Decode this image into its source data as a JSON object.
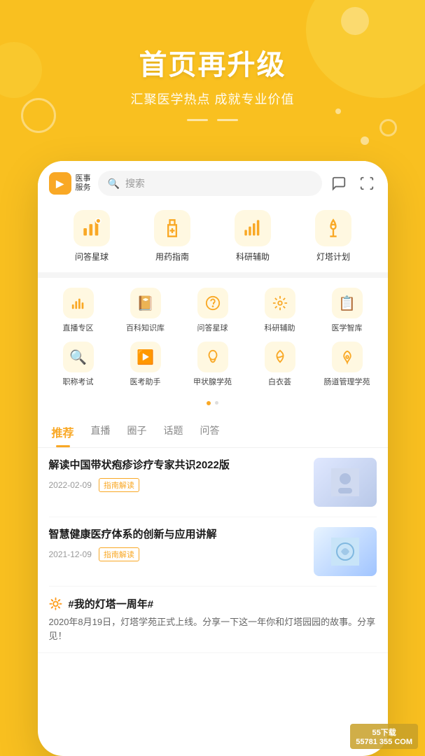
{
  "hero": {
    "title": "首页再升级",
    "subtitle": "汇聚医学热点 成就专业价值"
  },
  "search": {
    "placeholder": "搜索",
    "logo_line1": "医事",
    "logo_line2": "服务"
  },
  "main_nav": {
    "items": [
      {
        "label": "问答星球",
        "icon": "📊"
      },
      {
        "label": "用药指南",
        "icon": "💊"
      },
      {
        "label": "科研辅助",
        "icon": "📈"
      },
      {
        "label": "灯塔计划",
        "icon": "🎻"
      }
    ]
  },
  "secondary_grid": {
    "row1": [
      {
        "label": "直播专区",
        "icon": "📶"
      },
      {
        "label": "百科知识库",
        "icon": "📓"
      },
      {
        "label": "问答星球",
        "icon": "😊"
      },
      {
        "label": "科研辅助",
        "icon": "⚛"
      },
      {
        "label": "医学智库",
        "icon": "🗂"
      }
    ],
    "row2": [
      {
        "label": "职称考试",
        "icon": "🔍"
      },
      {
        "label": "医考助手",
        "icon": "▶"
      },
      {
        "label": "甲状腺学苑",
        "icon": "🫀"
      },
      {
        "label": "白衣荟",
        "icon": "🔥"
      },
      {
        "label": "肠道管理学苑",
        "icon": "🌀"
      }
    ]
  },
  "tabs": [
    {
      "label": "推荐",
      "active": true
    },
    {
      "label": "直播",
      "active": false
    },
    {
      "label": "圈子",
      "active": false
    },
    {
      "label": "话题",
      "active": false
    },
    {
      "label": "问答",
      "active": false
    }
  ],
  "articles": [
    {
      "title": "解读中国带状疱疹诊疗专家共识2022版",
      "date": "2022-02-09",
      "tag": "指南解读",
      "thumb_type": "medical"
    },
    {
      "title": "智慧健康医疗体系的创新与应用讲解",
      "date": "2021-12-09",
      "tag": "指南解读",
      "thumb_type": "tech"
    }
  ],
  "topic": {
    "icon": "🔆",
    "title": "#我的灯塔一周年#",
    "desc": "2020年8月19日，灯塔学苑正式上线。分享一下这一年你和灯塔园园的故事。分享见！"
  },
  "watermark": {
    "line1": "55下载",
    "line2": "55781 355 COM"
  }
}
